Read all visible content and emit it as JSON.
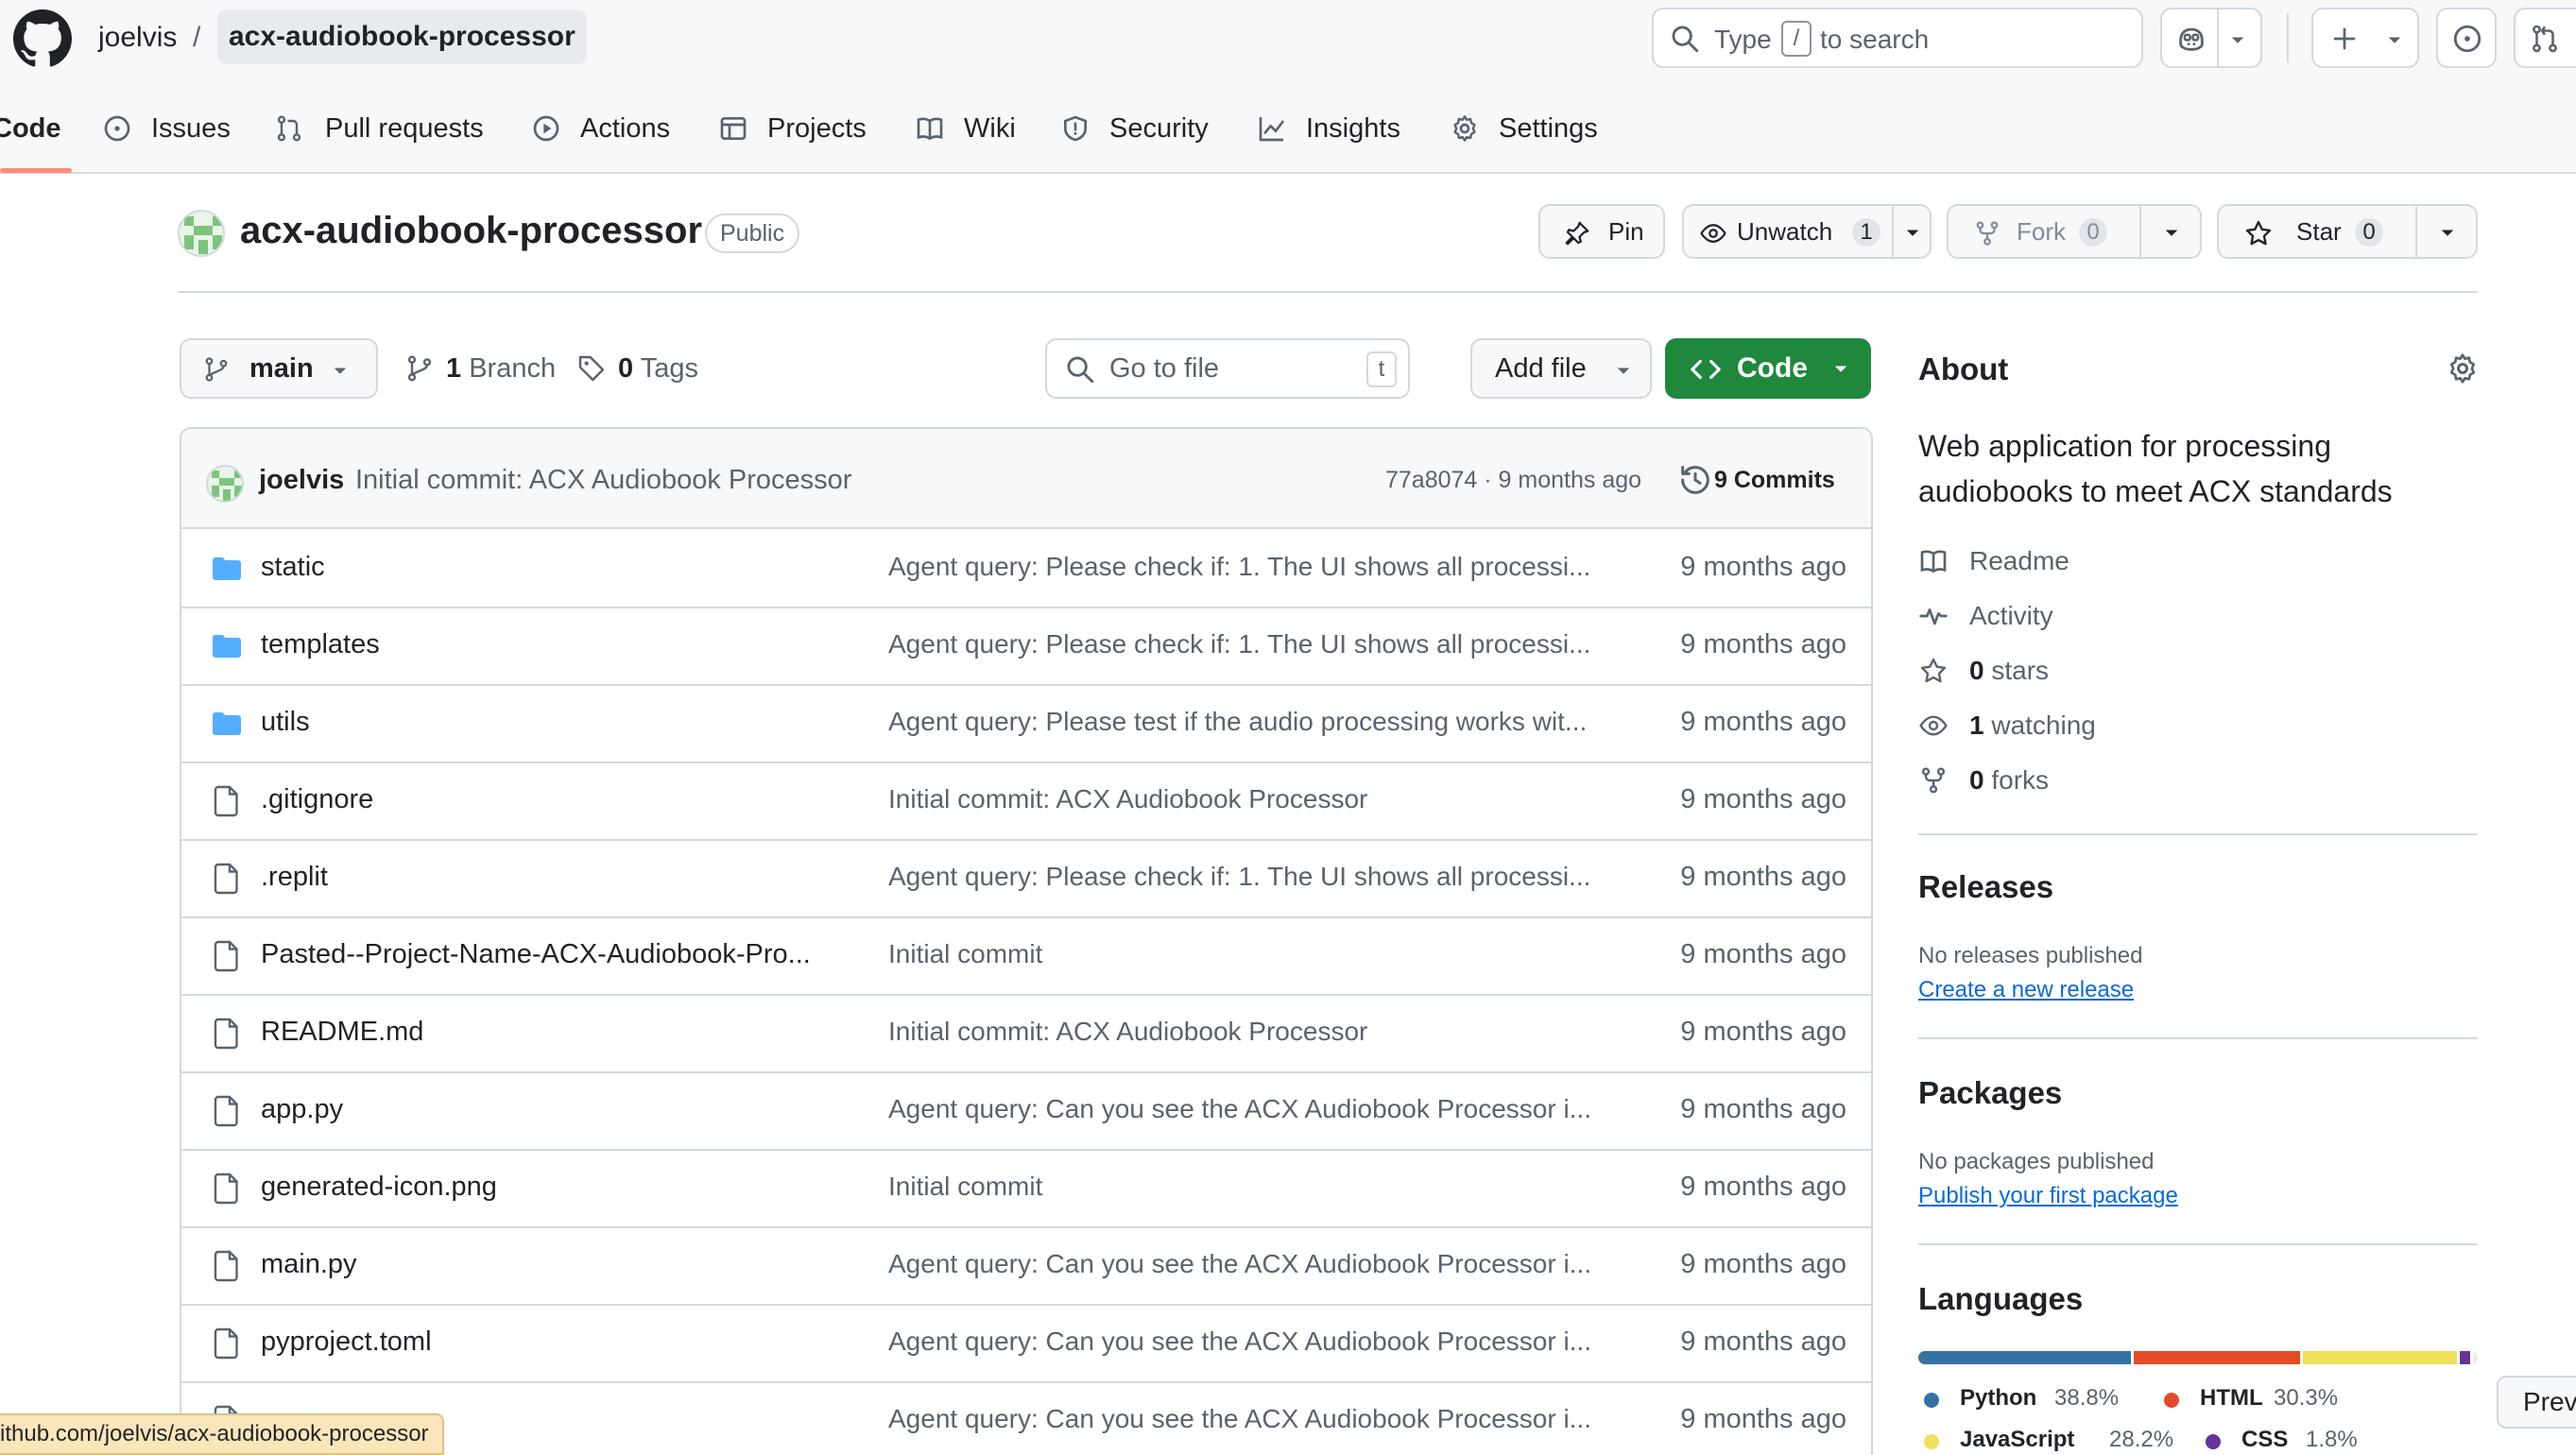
{
  "header": {
    "owner": "joelvis",
    "separator": "/",
    "repo": "acx-audiobook-processor",
    "search_prefix": "Type",
    "search_key": "/",
    "search_suffix": "to search"
  },
  "nav": {
    "tabs": [
      {
        "label": "Code",
        "icon": "code-icon",
        "active": true
      },
      {
        "label": "Issues",
        "icon": "issue-icon"
      },
      {
        "label": "Pull requests",
        "icon": "pull-request-icon"
      },
      {
        "label": "Actions",
        "icon": "play-icon"
      },
      {
        "label": "Projects",
        "icon": "table-icon"
      },
      {
        "label": "Wiki",
        "icon": "book-icon"
      },
      {
        "label": "Security",
        "icon": "shield-icon"
      },
      {
        "label": "Insights",
        "icon": "graph-icon"
      },
      {
        "label": "Settings",
        "icon": "gear-icon"
      }
    ]
  },
  "repo_header": {
    "title": "acx-audiobook-processor",
    "visibility": "Public",
    "pin_label": "Pin",
    "watch_label": "Unwatch",
    "watch_count": "1",
    "fork_label": "Fork",
    "fork_count": "0",
    "star_label": "Star",
    "star_count": "0"
  },
  "branch_bar": {
    "branch": "main",
    "branches_count": "1",
    "branches_label": "Branch",
    "tags_count": "0",
    "tags_label": "Tags",
    "goto_placeholder": "Go to file",
    "goto_key": "t",
    "add_file_label": "Add file",
    "code_label": "Code"
  },
  "latest_commit": {
    "author": "joelvis",
    "message": "Initial commit: ACX Audiobook Processor",
    "sha_and_time": "77a8074 · 9 months ago",
    "commits_label": "9 Commits"
  },
  "files": [
    {
      "name": "static",
      "type": "dir",
      "message": "Agent query: Please check if: 1. The UI shows all processi...",
      "age": "9 months ago"
    },
    {
      "name": "templates",
      "type": "dir",
      "message": "Agent query: Please check if: 1. The UI shows all processi...",
      "age": "9 months ago"
    },
    {
      "name": "utils",
      "type": "dir",
      "message": "Agent query: Please test if the audio processing works wit...",
      "age": "9 months ago"
    },
    {
      "name": ".gitignore",
      "type": "file",
      "message": "Initial commit: ACX Audiobook Processor",
      "age": "9 months ago"
    },
    {
      "name": ".replit",
      "type": "file",
      "message": "Agent query: Please check if: 1. The UI shows all processi...",
      "age": "9 months ago"
    },
    {
      "name": "Pasted--Project-Name-ACX-Audiobook-Pro...",
      "type": "file",
      "message": "Initial commit",
      "age": "9 months ago"
    },
    {
      "name": "README.md",
      "type": "file",
      "message": "Initial commit: ACX Audiobook Processor",
      "age": "9 months ago"
    },
    {
      "name": "app.py",
      "type": "file",
      "message": "Agent query: Can you see the ACX Audiobook Processor i...",
      "age": "9 months ago"
    },
    {
      "name": "generated-icon.png",
      "type": "file",
      "message": "Initial commit",
      "age": "9 months ago"
    },
    {
      "name": "main.py",
      "type": "file",
      "message": "Agent query: Can you see the ACX Audiobook Processor i...",
      "age": "9 months ago"
    },
    {
      "name": "pyproject.toml",
      "type": "file",
      "message": "Agent query: Can you see the ACX Audiobook Processor i...",
      "age": "9 months ago"
    },
    {
      "name": "",
      "type": "file",
      "message": "Agent query: Can you see the ACX Audiobook Processor i...",
      "age": "9 months ago"
    }
  ],
  "about": {
    "heading": "About",
    "description": "Web application for processing audiobooks to meet ACX standards",
    "readme": "Readme",
    "activity": "Activity",
    "stars_count": "0",
    "stars_label": "stars",
    "watching_count": "1",
    "watching_label": "watching",
    "forks_count": "0",
    "forks_label": "forks"
  },
  "releases": {
    "heading": "Releases",
    "none": "No releases published",
    "link": "Create a new release"
  },
  "packages": {
    "heading": "Packages",
    "none": "No packages published",
    "link": "Publish your first package"
  },
  "languages": {
    "heading": "Languages",
    "items": [
      {
        "name": "Python",
        "pct": "38.8%",
        "value": 38.8,
        "color": "#3572A5"
      },
      {
        "name": "HTML",
        "pct": "30.3%",
        "value": 30.3,
        "color": "#e34c26"
      },
      {
        "name": "JavaScript",
        "pct": "28.2%",
        "value": 28.2,
        "color": "#f1e05a"
      },
      {
        "name": "CSS",
        "pct": "1.8%",
        "value": 1.8,
        "color": "#663399"
      }
    ],
    "other_value": 0.9,
    "other_color": "#ededed"
  },
  "status_url": "ithub.com/joelvis/acx-audiobook-processor",
  "prev_label": "Prev"
}
